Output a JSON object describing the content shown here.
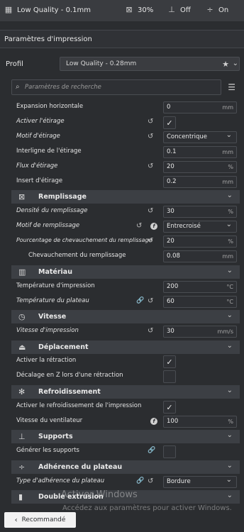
{
  "topbar": {
    "quality": "Low Quality - 0.1mm",
    "infill": "30%",
    "support": "Off",
    "adhesion": "On"
  },
  "panel": {
    "title": "Paramètres d'impression"
  },
  "profile": {
    "label": "Profil",
    "value": "Low Quality - 0.28mm"
  },
  "search": {
    "placeholder": "Paramètres de recherche"
  },
  "rows": [
    {
      "label": "Expansion horizontale",
      "value": "0",
      "unit": "mm"
    },
    {
      "label": "Activer l'étirage",
      "checked": "✓"
    },
    {
      "label": "Motif d'étirage",
      "value": "Concentrique"
    },
    {
      "label": "Interligne de l'étirage",
      "value": "0.1",
      "unit": "mm"
    },
    {
      "label": "Flux d'étirage",
      "value": "20",
      "unit": "%"
    },
    {
      "label": "Insert d'étirage",
      "value": "0.2",
      "unit": "mm"
    }
  ],
  "sections": {
    "remplissage": "Remplissage",
    "materiau": "Matériau",
    "vitesse": "Vitesse",
    "deplacement": "Déplacement",
    "refroidissement": "Refroidissement",
    "supports": "Supports",
    "adherence": "Adhérence du plateau",
    "double": "Double extrusion"
  },
  "remplissage_rows": [
    {
      "label": "Densité du remplissage",
      "value": "30",
      "unit": "%"
    },
    {
      "label": "Motif de remplissage",
      "value": "Entrecroisé"
    },
    {
      "label": "Pourcentage de chevauchement du remplissage",
      "value": "20",
      "unit": "%"
    },
    {
      "label": "Chevauchement du remplissage",
      "value": "0.08",
      "unit": "mm"
    }
  ],
  "materiau_rows": [
    {
      "label": "Température d'impression",
      "value": "200",
      "unit": "°C"
    },
    {
      "label": "Température du plateau",
      "value": "60",
      "unit": "°C"
    }
  ],
  "vitesse_rows": [
    {
      "label": "Vitesse d'impression",
      "value": "30",
      "unit": "mm/s"
    }
  ],
  "deplacement_rows": [
    {
      "label": "Activer la rétraction",
      "checked": "✓"
    },
    {
      "label": "Décalage en Z lors d'une rétraction",
      "checked": ""
    }
  ],
  "refroidissement_rows": [
    {
      "label": "Activer le refroidissement de l'impression",
      "checked": "✓"
    },
    {
      "label": "Vitesse du ventilateur",
      "value": "100",
      "unit": "%"
    }
  ],
  "supports_rows": [
    {
      "label": "Générer les supports",
      "checked": ""
    }
  ],
  "adherence_rows": [
    {
      "label": "Type d'adhérence du plateau",
      "value": "Bordure"
    }
  ],
  "watermark": {
    "line1": "Activer Windows",
    "line2": "Accédez aux paramètres pour activer Windows."
  },
  "bottom": {
    "recommended": "Recommandé"
  }
}
